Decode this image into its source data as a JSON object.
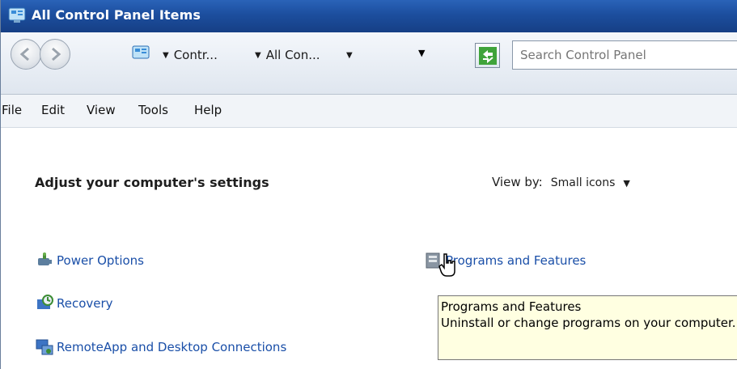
{
  "window": {
    "title": "All Control Panel Items"
  },
  "address_bar": {
    "crumbs": [
      "Contr...",
      "All Con..."
    ],
    "search_placeholder": "Search Control Panel"
  },
  "menu": [
    "File",
    "Edit",
    "View",
    "Tools",
    "Help"
  ],
  "content": {
    "heading": "Adjust your computer's settings",
    "view_by_label": "View by:",
    "view_by_value": "Small icons",
    "items_left": [
      "Power Options",
      "Recovery",
      "RemoteApp and Desktop Connections"
    ],
    "items_right": [
      "Programs and Features"
    ]
  },
  "tooltip": {
    "title": "Programs and Features",
    "description": "Uninstall or change programs on your computer."
  },
  "colors": {
    "title_bar": "#1c4e9e",
    "link": "#1a4fa8",
    "tooltip_bg": "#ffffe1"
  }
}
